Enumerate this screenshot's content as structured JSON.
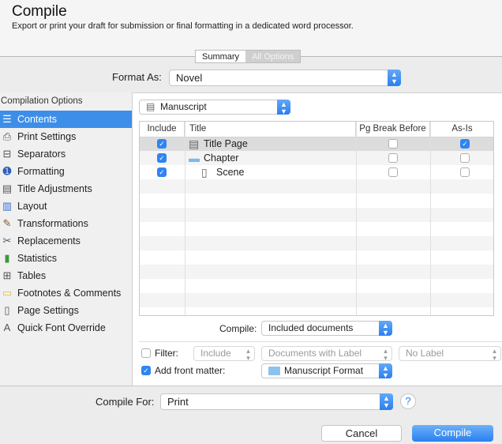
{
  "header": {
    "title": "Compile",
    "subtitle": "Export or print your draft for submission or final formatting in a dedicated word processor."
  },
  "tabs": [
    {
      "label": "Summary",
      "selected": true
    },
    {
      "label": "All Options",
      "selected": false
    }
  ],
  "format_as": {
    "label": "Format As:",
    "value": "Novel"
  },
  "sidebar": {
    "heading": "Compilation Options",
    "items": [
      {
        "label": "Contents",
        "icon": "list-icon",
        "selected": true
      },
      {
        "label": "Print Settings",
        "icon": "printer-icon"
      },
      {
        "label": "Separators",
        "icon": "separator-icon"
      },
      {
        "label": "Formatting",
        "icon": "formatting-icon"
      },
      {
        "label": "Title Adjustments",
        "icon": "document-icon"
      },
      {
        "label": "Layout",
        "icon": "layout-icon"
      },
      {
        "label": "Transformations",
        "icon": "brush-icon"
      },
      {
        "label": "Replacements",
        "icon": "tools-icon"
      },
      {
        "label": "Statistics",
        "icon": "bar-chart-icon"
      },
      {
        "label": "Tables",
        "icon": "table-icon"
      },
      {
        "label": "Footnotes & Comments",
        "icon": "note-icon"
      },
      {
        "label": "Page Settings",
        "icon": "page-icon"
      },
      {
        "label": "Quick Font Override",
        "icon": "font-icon"
      }
    ]
  },
  "preset": {
    "value": "Manuscript"
  },
  "table": {
    "headers": [
      "Include",
      "Title",
      "Pg Break Before",
      "As-Is"
    ],
    "rows": [
      {
        "include": true,
        "title": "Title Page",
        "icon": "document-icon",
        "pg_break": false,
        "as_is": true
      },
      {
        "include": true,
        "title": "Chapter",
        "icon": "folder-icon",
        "pg_break": false,
        "as_is": false
      },
      {
        "include": true,
        "title": "Scene",
        "icon": "page-icon",
        "pg_break": false,
        "as_is": false
      }
    ]
  },
  "compile_select": {
    "label": "Compile:",
    "value": "Included documents"
  },
  "filter": {
    "label": "Filter:",
    "checked": false,
    "mode": "Include",
    "type": "Documents with Label",
    "value": "No Label"
  },
  "front_matter": {
    "label": "Add front matter:",
    "checked": true,
    "value": "Manuscript Format"
  },
  "compile_for": {
    "label": "Compile For:",
    "value": "Print"
  },
  "buttons": {
    "help": "?",
    "cancel": "Cancel",
    "compile": "Compile"
  }
}
